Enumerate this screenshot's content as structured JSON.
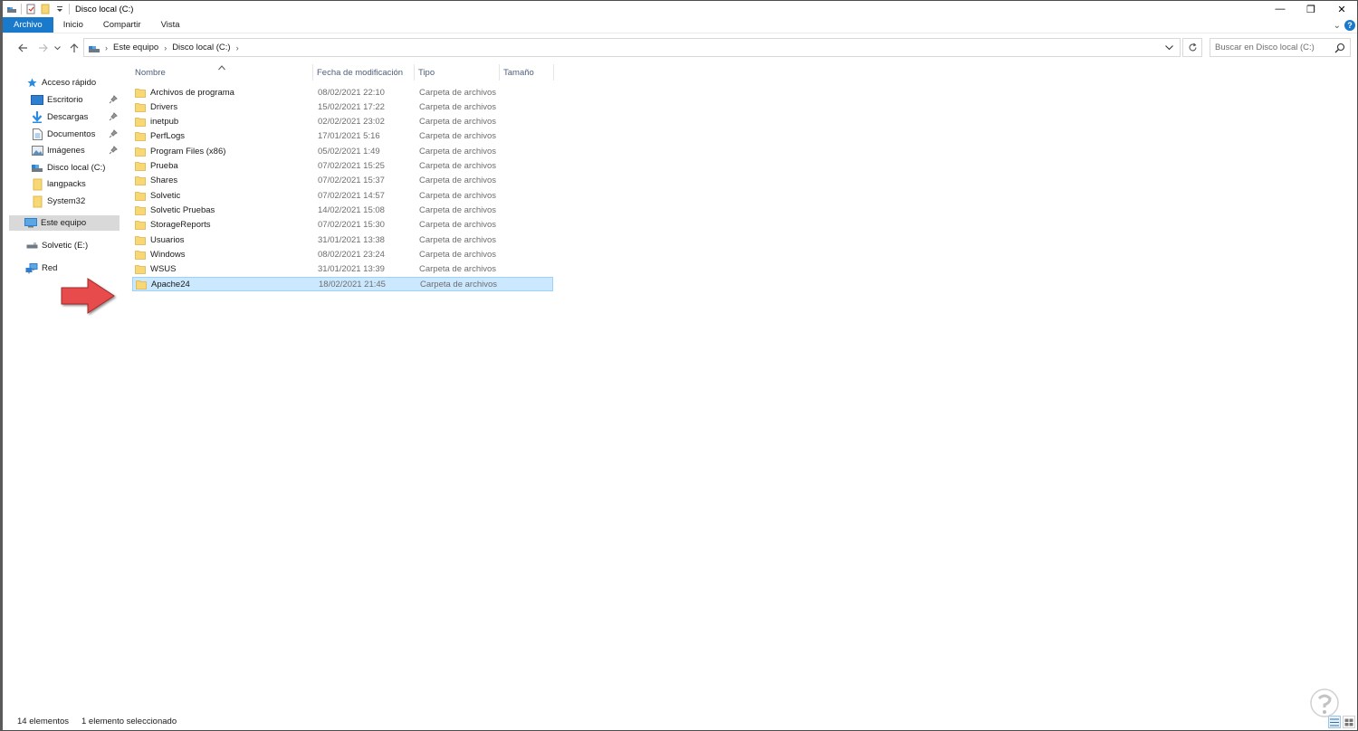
{
  "window": {
    "title": "Disco local (C:)",
    "controls": {
      "minimize": "—",
      "maximize": "❐",
      "close": "✕"
    }
  },
  "ribbon": {
    "tabs": [
      "Archivo",
      "Inicio",
      "Compartir",
      "Vista"
    ],
    "active_tab": "Archivo",
    "expand_glyph": "⌄",
    "help": "?"
  },
  "address": {
    "breadcrumbs": [
      "Este equipo",
      "Disco local (C:)"
    ],
    "separator": "›"
  },
  "search": {
    "placeholder": "Buscar en Disco local (C:)"
  },
  "sidebar": {
    "items": [
      {
        "label": "Acceso rápido",
        "icon": "star-icon",
        "pinned": false
      },
      {
        "label": "Escritorio",
        "icon": "desktop-icon",
        "pinned": true
      },
      {
        "label": "Descargas",
        "icon": "download-icon",
        "pinned": true
      },
      {
        "label": "Documentos",
        "icon": "document-icon",
        "pinned": true
      },
      {
        "label": "Imágenes",
        "icon": "images-icon",
        "pinned": true
      },
      {
        "label": "Disco local (C:)",
        "icon": "drive-icon",
        "pinned": false
      },
      {
        "label": "langpacks",
        "icon": "folder-icon",
        "pinned": false
      },
      {
        "label": "System32",
        "icon": "folder-icon",
        "pinned": false
      },
      {
        "label": "Este equipo",
        "icon": "computer-icon",
        "pinned": false,
        "selected": true
      },
      {
        "label": "Solvetic (E:)",
        "icon": "usb-drive-icon",
        "pinned": false
      },
      {
        "label": "Red",
        "icon": "network-icon",
        "pinned": false
      }
    ]
  },
  "columns": {
    "name": "Nombre",
    "date": "Fecha de modificación",
    "type": "Tipo",
    "size": "Tamaño"
  },
  "files": [
    {
      "name": "Archivos de programa",
      "date": "08/02/2021 22:10",
      "type": "Carpeta de archivos"
    },
    {
      "name": "Drivers",
      "date": "15/02/2021 17:22",
      "type": "Carpeta de archivos"
    },
    {
      "name": "inetpub",
      "date": "02/02/2021 23:02",
      "type": "Carpeta de archivos"
    },
    {
      "name": "PerfLogs",
      "date": "17/01/2021 5:16",
      "type": "Carpeta de archivos"
    },
    {
      "name": "Program Files (x86)",
      "date": "05/02/2021 1:49",
      "type": "Carpeta de archivos"
    },
    {
      "name": "Prueba",
      "date": "07/02/2021 15:25",
      "type": "Carpeta de archivos"
    },
    {
      "name": "Shares",
      "date": "07/02/2021 15:37",
      "type": "Carpeta de archivos"
    },
    {
      "name": "Solvetic",
      "date": "07/02/2021 14:57",
      "type": "Carpeta de archivos"
    },
    {
      "name": "Solvetic Pruebas",
      "date": "14/02/2021 15:08",
      "type": "Carpeta de archivos"
    },
    {
      "name": "StorageReports",
      "date": "07/02/2021 15:30",
      "type": "Carpeta de archivos"
    },
    {
      "name": "Usuarios",
      "date": "31/01/2021 13:38",
      "type": "Carpeta de archivos"
    },
    {
      "name": "Windows",
      "date": "08/02/2021 23:24",
      "type": "Carpeta de archivos"
    },
    {
      "name": "WSUS",
      "date": "31/01/2021 13:39",
      "type": "Carpeta de archivos"
    },
    {
      "name": "Apache24",
      "date": "18/02/2021 21:45",
      "type": "Carpeta de archivos",
      "selected": true
    }
  ],
  "status": {
    "count": "14 elementos",
    "selection": "1 elemento seleccionado"
  },
  "colors": {
    "accent": "#1979ca",
    "folder": "#f8d775",
    "selection_bg": "#cce8ff",
    "selection_border": "#99d1ff",
    "annotation_arrow": "#e84b4b"
  }
}
